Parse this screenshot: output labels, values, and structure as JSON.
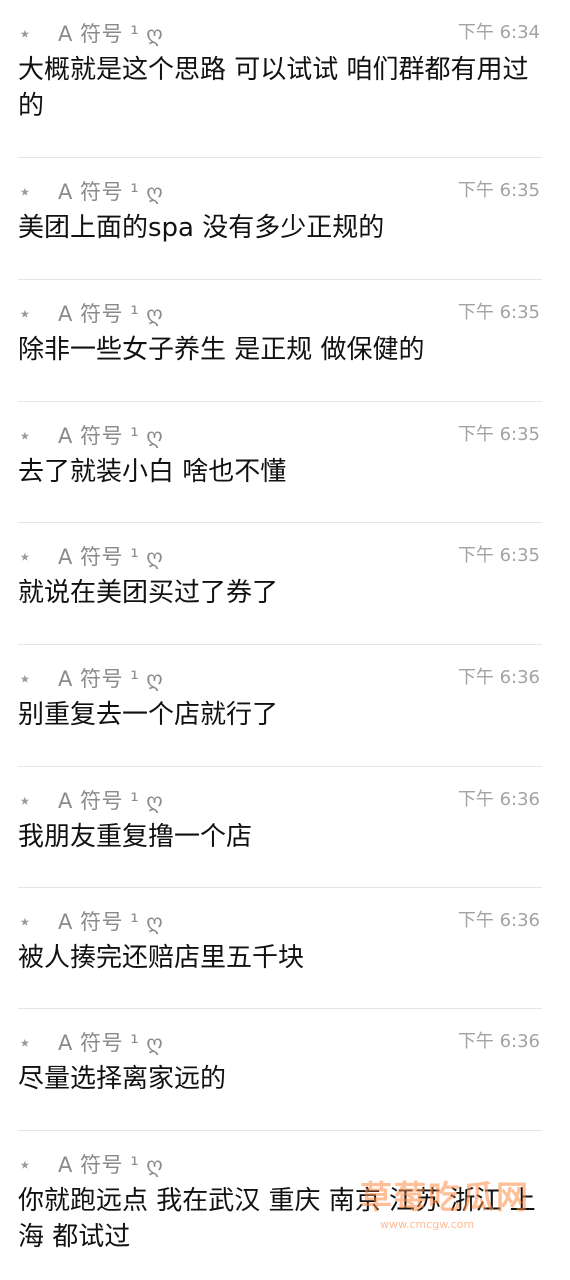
{
  "sender_icon": "star-icon",
  "messages": [
    {
      "sender": "A 符号 ¹ ღ",
      "time": "下午 6:34",
      "text": "大概就是这个思路 可以试试 咱们群都有用过的"
    },
    {
      "sender": "A 符号 ¹ ღ",
      "time": "下午 6:35",
      "text": "美团上面的spa 没有多少正规的"
    },
    {
      "sender": "A 符号 ¹ ღ",
      "time": "下午 6:35",
      "text": "除非一些女子养生 是正规 做保健的"
    },
    {
      "sender": "A 符号 ¹ ღ",
      "time": "下午 6:35",
      "text": "去了就装小白 啥也不懂"
    },
    {
      "sender": "A 符号 ¹ ღ",
      "time": "下午 6:35",
      "text": "就说在美团买过了券了"
    },
    {
      "sender": "A 符号 ¹ ღ",
      "time": "下午 6:36",
      "text": "别重复去一个店就行了"
    },
    {
      "sender": "A 符号 ¹ ღ",
      "time": "下午 6:36",
      "text": "我朋友重复撸一个店"
    },
    {
      "sender": "A 符号 ¹ ღ",
      "time": "下午 6:36",
      "text": "被人揍完还赔店里五千块"
    },
    {
      "sender": "A 符号 ¹ ღ",
      "time": "下午 6:36",
      "text": "尽量选择离家远的"
    },
    {
      "sender": "A 符号 ¹ ღ",
      "time": "",
      "text": "你就跑远点 我在武汉 重庆 南京 江苏 浙江 上海 都试过"
    }
  ],
  "watermark": {
    "title": "草莓吃瓜网",
    "url": "www.cmcgw.com"
  }
}
